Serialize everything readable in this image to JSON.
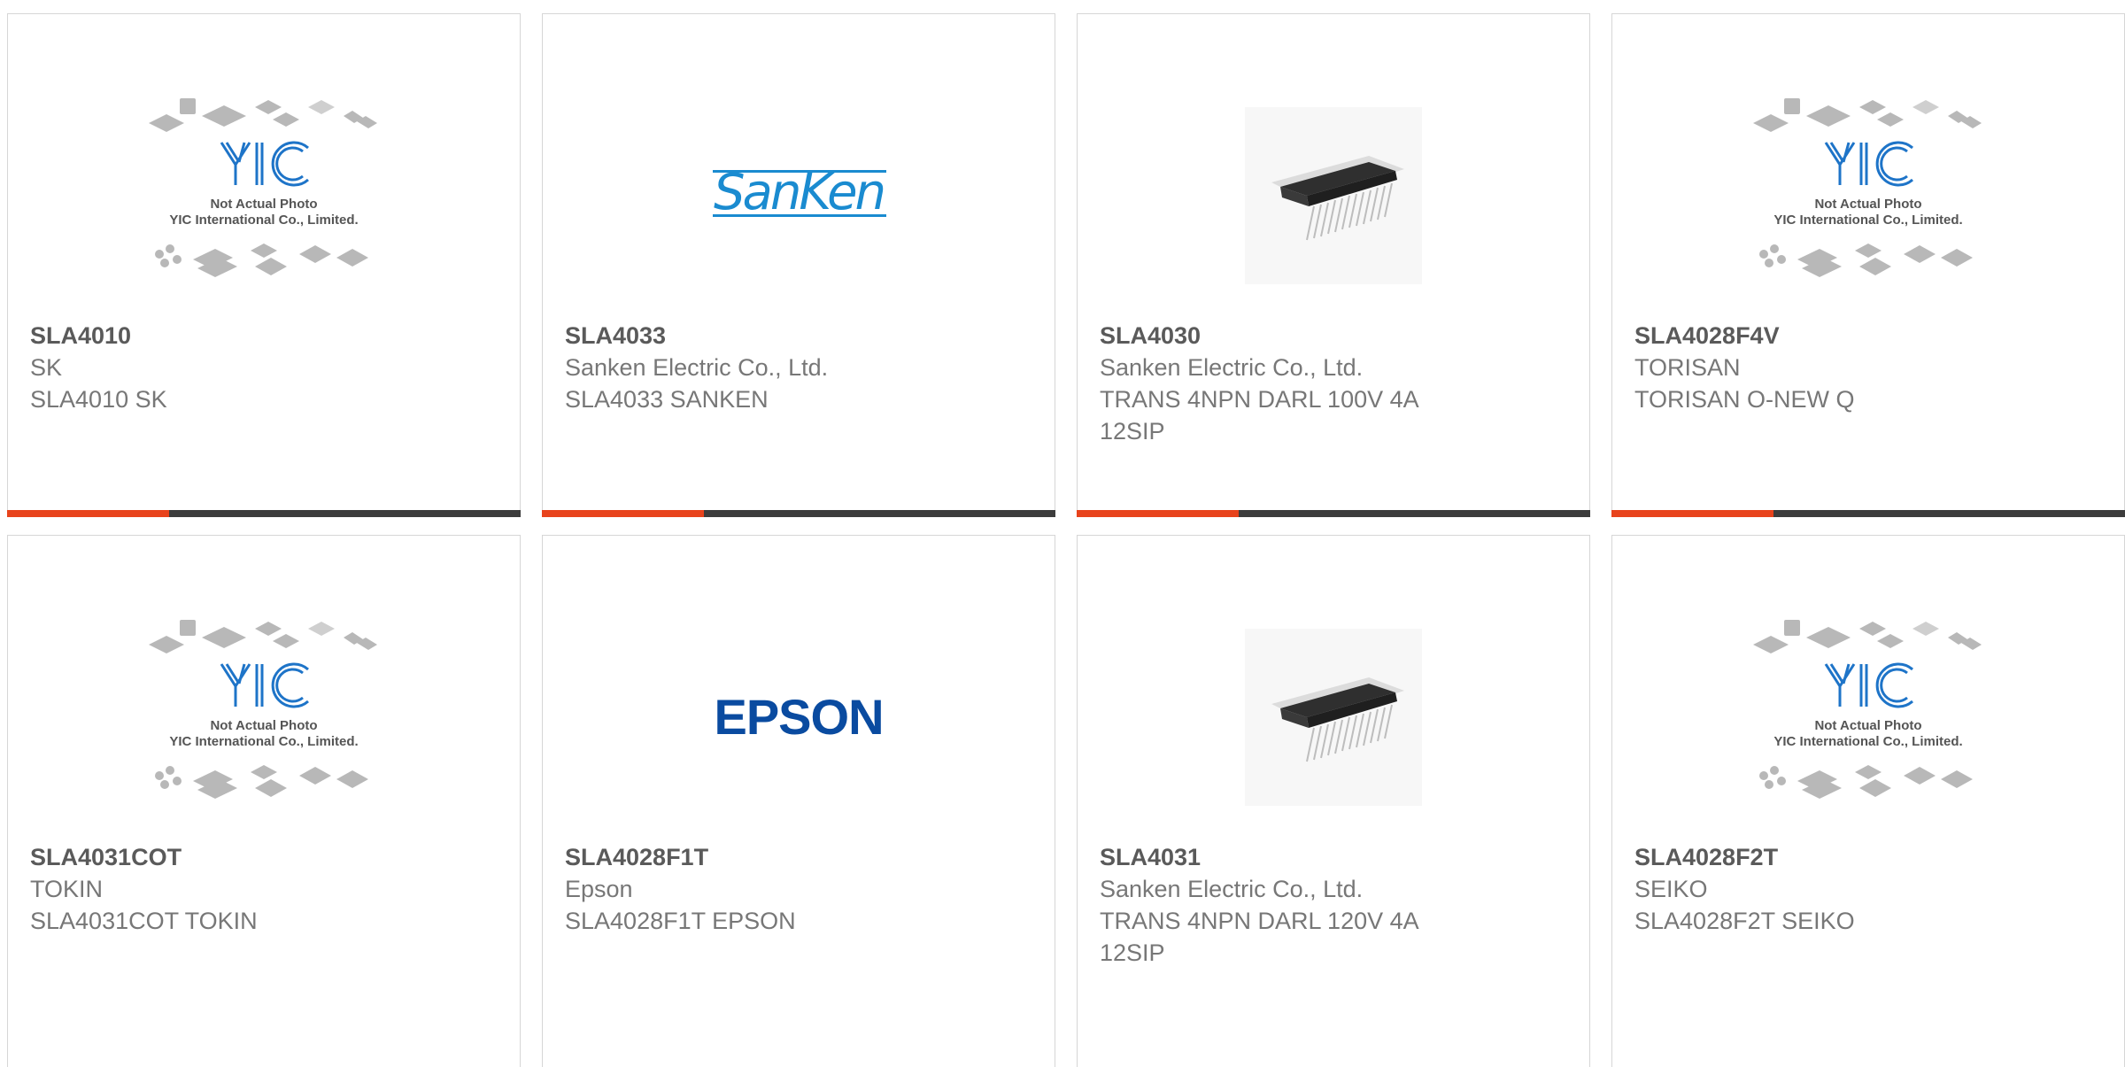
{
  "placeholder": {
    "line1": "Not Actual Photo",
    "line2": "YIC International Co., Limited."
  },
  "logos": {
    "sanken": "SanKen",
    "epson": "EPSON"
  },
  "colors": {
    "accent": "#e8431c",
    "bar": "#3c3c3c",
    "yic_blue": "#1e74c8",
    "sanken_blue": "#1a8bd0",
    "epson_blue": "#0a4ba0"
  },
  "products": [
    {
      "pn": "SLA4010",
      "mfr": "SK",
      "desc": "SLA4010 SK",
      "image": "yic-placeholder"
    },
    {
      "pn": "SLA4033",
      "mfr": "Sanken Electric Co., Ltd.",
      "desc": "SLA4033 SANKEN",
      "image": "sanken-logo"
    },
    {
      "pn": "SLA4030",
      "mfr": "Sanken Electric Co., Ltd.",
      "desc": "TRANS 4NPN DARL 100V 4A 12SIP",
      "image": "sip-chip-photo"
    },
    {
      "pn": "SLA4028F4V",
      "mfr": "TORISAN",
      "desc": "TORISAN O-NEW Q",
      "image": "yic-placeholder"
    },
    {
      "pn": "SLA4031COT",
      "mfr": "TOKIN",
      "desc": "SLA4031COT TOKIN",
      "image": "yic-placeholder"
    },
    {
      "pn": "SLA4028F1T",
      "mfr": "Epson",
      "desc": "SLA4028F1T EPSON",
      "image": "epson-logo"
    },
    {
      "pn": "SLA4031",
      "mfr": "Sanken Electric Co., Ltd.",
      "desc": "TRANS 4NPN DARL 120V 4A 12SIP",
      "image": "sip-chip-photo"
    },
    {
      "pn": "SLA4028F2T",
      "mfr": "SEIKO",
      "desc": "SLA4028F2T SEIKO",
      "image": "yic-placeholder"
    }
  ]
}
